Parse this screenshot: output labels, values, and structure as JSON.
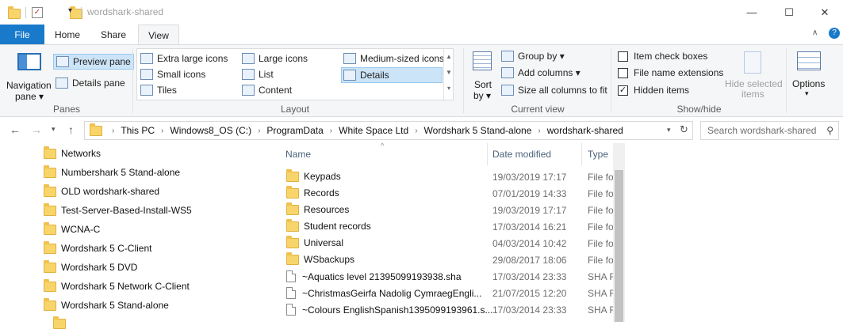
{
  "window": {
    "title": "wordshark-shared",
    "qat_dropdown": "▾",
    "minimize": "—",
    "maximize": "☐",
    "close": "✕"
  },
  "tabs": [
    {
      "label": "File"
    },
    {
      "label": "Home"
    },
    {
      "label": "Share"
    },
    {
      "label": "View"
    }
  ],
  "ribbon": {
    "panes": {
      "navigation_pane": "Navigation",
      "navigation_pane_2": "pane ▾",
      "preview_pane": "Preview pane",
      "details_pane": "Details pane",
      "group": "Panes"
    },
    "layout": {
      "items": [
        "Extra large icons",
        "Large icons",
        "Medium-sized icons",
        "Small icons",
        "List",
        "Details",
        "Tiles",
        "Content"
      ],
      "group": "Layout"
    },
    "current_view": {
      "sort_by": "Sort",
      "sort_by_2": "by ▾",
      "group_by": "Group by ▾",
      "add_columns": "Add columns ▾",
      "size_all": "Size all columns to fit",
      "group": "Current view"
    },
    "show_hide": {
      "item_check_boxes": "Item check boxes",
      "file_name_extensions": "File name extensions",
      "hidden_items": "Hidden items",
      "hide_selected": "Hide selected",
      "hide_selected_2": "items",
      "group": "Show/hide"
    },
    "options": {
      "label": "Options",
      "arrow": "▾"
    }
  },
  "address": {
    "crumbs": [
      "This PC",
      "Windows8_OS (C:)",
      "ProgramData",
      "White Space Ltd",
      "Wordshark 5 Stand-alone",
      "wordshark-shared"
    ],
    "search_placeholder": "Search wordshark-shared"
  },
  "nav_pane": {
    "items": [
      "Networks",
      "Numbershark 5 Stand-alone",
      "OLD wordshark-shared",
      "Test-Server-Based-Install-WS5",
      "WCNA-C",
      "Wordshark 5 C-Client",
      "Wordshark 5 DVD",
      "Wordshark 5 Network C-Client",
      "Wordshark 5 Stand-alone"
    ]
  },
  "file_list": {
    "columns": {
      "name": "Name",
      "date": "Date modified",
      "type": "Type"
    },
    "rows": [
      {
        "name": "Keypads",
        "date": "19/03/2019 17:17",
        "type": "File fo",
        "kind": "folder"
      },
      {
        "name": "Records",
        "date": "07/01/2019 14:33",
        "type": "File fo",
        "kind": "folder"
      },
      {
        "name": "Resources",
        "date": "19/03/2019 17:17",
        "type": "File fo",
        "kind": "folder"
      },
      {
        "name": "Student records",
        "date": "17/03/2014 16:21",
        "type": "File fo",
        "kind": "folder"
      },
      {
        "name": "Universal",
        "date": "04/03/2014 10:42",
        "type": "File fo",
        "kind": "folder"
      },
      {
        "name": "WSbackups",
        "date": "29/08/2017 18:06",
        "type": "File fo",
        "kind": "folder"
      },
      {
        "name": "~Aquatics level 21395099193938.sha",
        "date": "17/03/2014 23:33",
        "type": "SHA F",
        "kind": "file"
      },
      {
        "name": "~ChristmasGeirfa Nadolig CymraegEngli...",
        "date": "21/07/2015 12:20",
        "type": "SHA F",
        "kind": "file"
      },
      {
        "name": "~Colours EnglishSpanish1395099193961.s...",
        "date": "17/03/2014 23:33",
        "type": "SHA F",
        "kind": "file"
      }
    ]
  }
}
